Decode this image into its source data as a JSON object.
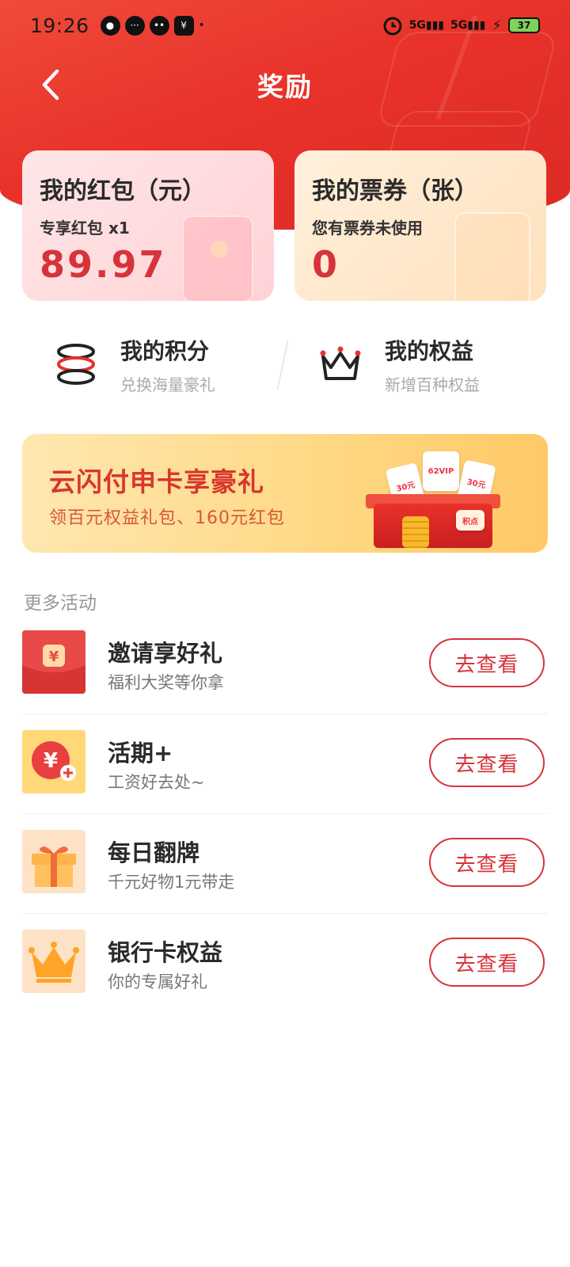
{
  "status_bar": {
    "time": "19:26",
    "signal1": "5G",
    "signal2": "5G",
    "battery": "37"
  },
  "nav": {
    "title": "奖励"
  },
  "cards": {
    "red_packet": {
      "title": "我的红包（元）",
      "sub": "专享红包 x1",
      "value": "89.97"
    },
    "tickets": {
      "title": "我的票券（张）",
      "sub": "您有票券未使用",
      "value": "0"
    }
  },
  "quick": {
    "points": {
      "title": "我的积分",
      "sub": "兑换海量豪礼"
    },
    "rights": {
      "title": "我的权益",
      "sub": "新增百种权益"
    }
  },
  "banner": {
    "title": "云闪付申卡享豪礼",
    "sub": "领百元权益礼包、160元红包",
    "card_labels": [
      "30元",
      "62VIP",
      "30元",
      "积点"
    ]
  },
  "more": {
    "section_title": "更多活动",
    "items": [
      {
        "title": "邀请享好礼",
        "sub": "福利大奖等你拿",
        "button": "去查看",
        "icon": "red-envelope-icon"
      },
      {
        "title": "活期+",
        "sub": "工资好去处~",
        "button": "去查看",
        "icon": "yuan-coin-plus-icon"
      },
      {
        "title": "每日翻牌",
        "sub": "千元好物1元带走",
        "button": "去查看",
        "icon": "gift-box-icon"
      },
      {
        "title": "银行卡权益",
        "sub": "你的专属好礼",
        "button": "去查看",
        "icon": "crown-icon"
      }
    ]
  },
  "colors": {
    "brand_red": "#e8322a",
    "accent_red": "#d6343a"
  }
}
